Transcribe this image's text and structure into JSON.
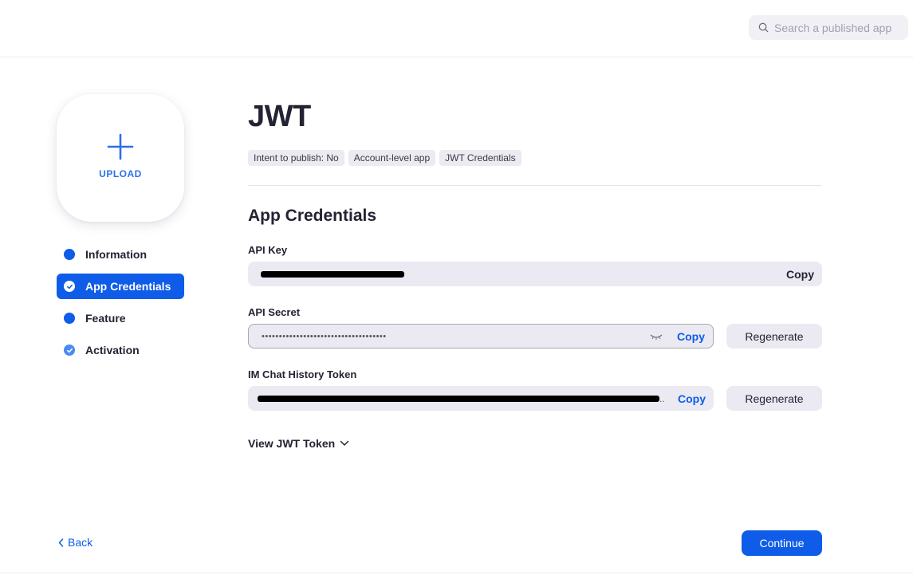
{
  "header": {
    "search_placeholder": "Search a published app",
    "search_icon": "search-icon"
  },
  "upload": {
    "label": "UPLOAD",
    "icon": "plus-icon"
  },
  "steps": [
    {
      "label": "Information",
      "state": "complete"
    },
    {
      "label": "App Credentials",
      "state": "active"
    },
    {
      "label": "Feature",
      "state": "complete"
    },
    {
      "label": "Activation",
      "state": "checked"
    }
  ],
  "main": {
    "title": "JWT",
    "tags": [
      "Intent to publish: No",
      "Account-level app",
      "JWT Credentials"
    ],
    "section_title": "App Credentials",
    "fields": {
      "api_key": {
        "label": "API Key",
        "value_redacted": true,
        "copy_label": "Copy"
      },
      "api_secret": {
        "label": "API Secret",
        "value_masked": "••••••••••••••••••••••••••••••••••••",
        "copy_label": "Copy",
        "regenerate_label": "Regenerate"
      },
      "im_chat_token": {
        "label": "IM Chat History Token",
        "value_redacted": true,
        "ellipsis": "..",
        "copy_label": "Copy",
        "regenerate_label": "Regenerate"
      }
    },
    "view_token_label": "View JWT Token"
  },
  "footer": {
    "back_label": "Back",
    "continue_label": "Continue"
  },
  "colors": {
    "accent": "#0e5ce8",
    "upload_accent": "#2d6fe8",
    "input_bg": "#ebeaf2",
    "text": "#232333"
  }
}
